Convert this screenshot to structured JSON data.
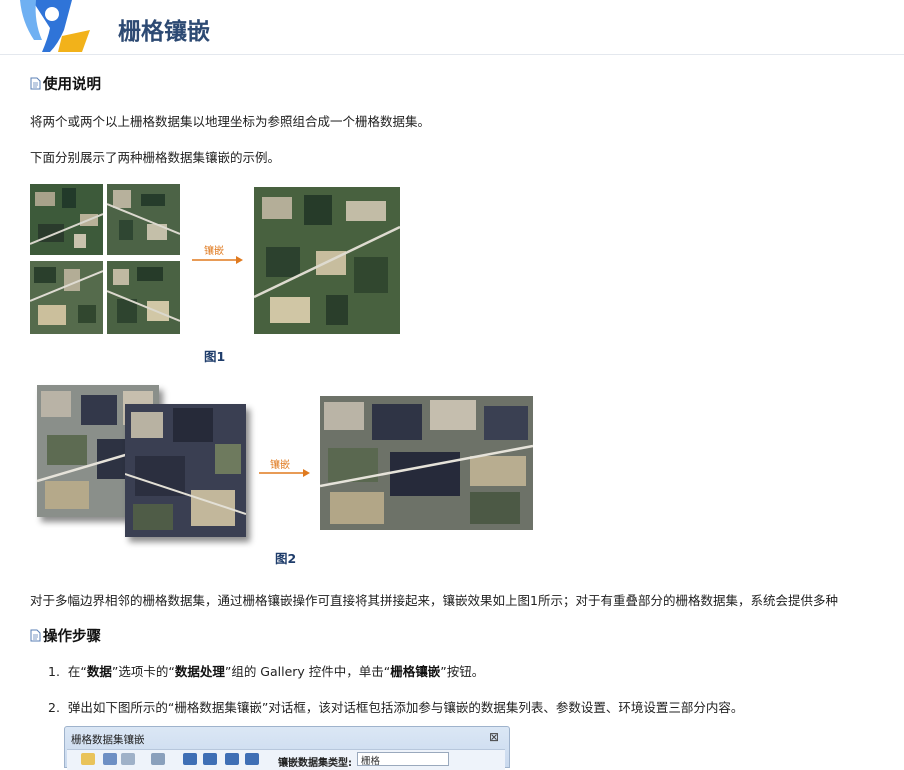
{
  "header": {
    "title": "栅格镶嵌",
    "logo_icon": "map-pin-logo-icon"
  },
  "sections": {
    "usage_title": "使用说明",
    "steps_title": "操作步骤"
  },
  "paragraphs": {
    "intro": "将两个或两个以上栅格数据集以地理坐标为参照组合成一个栅格数据集。",
    "examples": "下面分别展示了两种栅格数据集镶嵌的示例。",
    "description": "对于多幅边界相邻的栅格数据集，通过栅格镶嵌操作可直接将其拼接起来，镶嵌效果如上图1所示；对于有重叠部分的栅格数据集，系统会提供多种"
  },
  "figures": {
    "fig1_caption": "图1",
    "fig2_caption": "图2",
    "arrow_label": "镶嵌"
  },
  "steps": [
    {
      "num": "1.",
      "p1": "在“",
      "b1": "数据",
      "p2": "”选项卡的“",
      "b2": "数据处理",
      "p3": "”组的 Gallery 控件中，单击“",
      "b3": "栅格镶嵌",
      "p4": "”按钮。"
    },
    {
      "num": "2.",
      "text": "弹出如下图所示的“栅格数据集镶嵌”对话框，该对话框包括添加参与镶嵌的数据集列表、参数设置、环境设置三部分内容。"
    }
  ],
  "dialog": {
    "title": "栅格数据集镶嵌",
    "close": "⊠",
    "type_label": "镶嵌数据集类型:",
    "type_value": "栅格"
  },
  "colors": {
    "title": "#2d4a73",
    "caption": "#1f3d6b",
    "arrow": "#e07a1f"
  }
}
